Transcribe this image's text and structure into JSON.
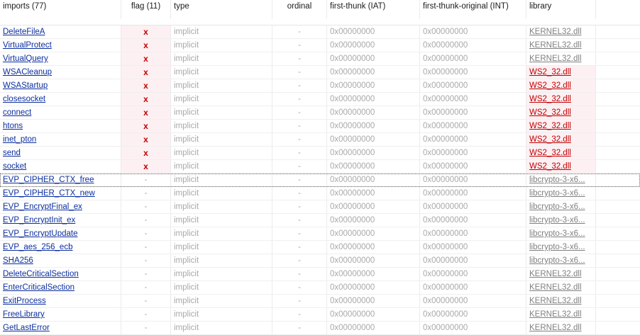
{
  "headers": {
    "imports": "imports (77)",
    "flag": "flag (11)",
    "type": "type",
    "ordinal": "ordinal",
    "iat": "first-thunk (IAT)",
    "int": "first-thunk-original (INT)",
    "library": "library"
  },
  "rows": [
    {
      "name": "DeleteFileA",
      "flag": "x",
      "type": "implicit",
      "ordinal": "-",
      "iat": "0x00000000",
      "int": "0x00000000",
      "library": "KERNEL32.dll",
      "flagged": true
    },
    {
      "name": "VirtualProtect",
      "flag": "x",
      "type": "implicit",
      "ordinal": "-",
      "iat": "0x00000000",
      "int": "0x00000000",
      "library": "KERNEL32.dll",
      "flagged": true
    },
    {
      "name": "VirtualQuery",
      "flag": "x",
      "type": "implicit",
      "ordinal": "-",
      "iat": "0x00000000",
      "int": "0x00000000",
      "library": "KERNEL32.dll",
      "flagged": true
    },
    {
      "name": "WSACleanup",
      "flag": "x",
      "type": "implicit",
      "ordinal": "-",
      "iat": "0x00000000",
      "int": "0x00000000",
      "library": "WS2_32.dll",
      "flagged": true,
      "lib_flagged": true
    },
    {
      "name": "WSAStartup",
      "flag": "x",
      "type": "implicit",
      "ordinal": "-",
      "iat": "0x00000000",
      "int": "0x00000000",
      "library": "WS2_32.dll",
      "flagged": true,
      "lib_flagged": true
    },
    {
      "name": "closesocket",
      "flag": "x",
      "type": "implicit",
      "ordinal": "-",
      "iat": "0x00000000",
      "int": "0x00000000",
      "library": "WS2_32.dll",
      "flagged": true,
      "lib_flagged": true
    },
    {
      "name": "connect",
      "flag": "x",
      "type": "implicit",
      "ordinal": "-",
      "iat": "0x00000000",
      "int": "0x00000000",
      "library": "WS2_32.dll",
      "flagged": true,
      "lib_flagged": true
    },
    {
      "name": "htons",
      "flag": "x",
      "type": "implicit",
      "ordinal": "-",
      "iat": "0x00000000",
      "int": "0x00000000",
      "library": "WS2_32.dll",
      "flagged": true,
      "lib_flagged": true
    },
    {
      "name": "inet_pton",
      "flag": "x",
      "type": "implicit",
      "ordinal": "-",
      "iat": "0x00000000",
      "int": "0x00000000",
      "library": "WS2_32.dll",
      "flagged": true,
      "lib_flagged": true
    },
    {
      "name": "send",
      "flag": "x",
      "type": "implicit",
      "ordinal": "-",
      "iat": "0x00000000",
      "int": "0x00000000",
      "library": "WS2_32.dll",
      "flagged": true,
      "lib_flagged": true
    },
    {
      "name": "socket",
      "flag": "x",
      "type": "implicit",
      "ordinal": "-",
      "iat": "0x00000000",
      "int": "0x00000000",
      "library": "WS2_32.dll",
      "flagged": true,
      "lib_flagged": true
    },
    {
      "name": "EVP_CIPHER_CTX_free",
      "flag": "-",
      "type": "implicit",
      "ordinal": "-",
      "iat": "0x00000000",
      "int": "0x00000000",
      "library": "libcrypto-3-x6...",
      "selected": true
    },
    {
      "name": "EVP_CIPHER_CTX_new",
      "flag": "-",
      "type": "implicit",
      "ordinal": "-",
      "iat": "0x00000000",
      "int": "0x00000000",
      "library": "libcrypto-3-x6..."
    },
    {
      "name": "EVP_EncryptFinal_ex",
      "flag": "-",
      "type": "implicit",
      "ordinal": "-",
      "iat": "0x00000000",
      "int": "0x00000000",
      "library": "libcrypto-3-x6..."
    },
    {
      "name": "EVP_EncryptInit_ex",
      "flag": "-",
      "type": "implicit",
      "ordinal": "-",
      "iat": "0x00000000",
      "int": "0x00000000",
      "library": "libcrypto-3-x6..."
    },
    {
      "name": "EVP_EncryptUpdate",
      "flag": "-",
      "type": "implicit",
      "ordinal": "-",
      "iat": "0x00000000",
      "int": "0x00000000",
      "library": "libcrypto-3-x6..."
    },
    {
      "name": "EVP_aes_256_ecb",
      "flag": "-",
      "type": "implicit",
      "ordinal": "-",
      "iat": "0x00000000",
      "int": "0x00000000",
      "library": "libcrypto-3-x6..."
    },
    {
      "name": "SHA256",
      "flag": "-",
      "type": "implicit",
      "ordinal": "-",
      "iat": "0x00000000",
      "int": "0x00000000",
      "library": "libcrypto-3-x6..."
    },
    {
      "name": "DeleteCriticalSection",
      "flag": "-",
      "type": "implicit",
      "ordinal": "-",
      "iat": "0x00000000",
      "int": "0x00000000",
      "library": "KERNEL32.dll"
    },
    {
      "name": "EnterCriticalSection",
      "flag": "-",
      "type": "implicit",
      "ordinal": "-",
      "iat": "0x00000000",
      "int": "0x00000000",
      "library": "KERNEL32.dll"
    },
    {
      "name": "ExitProcess",
      "flag": "-",
      "type": "implicit",
      "ordinal": "-",
      "iat": "0x00000000",
      "int": "0x00000000",
      "library": "KERNEL32.dll"
    },
    {
      "name": "FreeLibrary",
      "flag": "-",
      "type": "implicit",
      "ordinal": "-",
      "iat": "0x00000000",
      "int": "0x00000000",
      "library": "KERNEL32.dll"
    },
    {
      "name": "GetLastError",
      "flag": "-",
      "type": "implicit",
      "ordinal": "-",
      "iat": "0x00000000",
      "int": "0x00000000",
      "library": "KERNEL32.dll"
    }
  ]
}
